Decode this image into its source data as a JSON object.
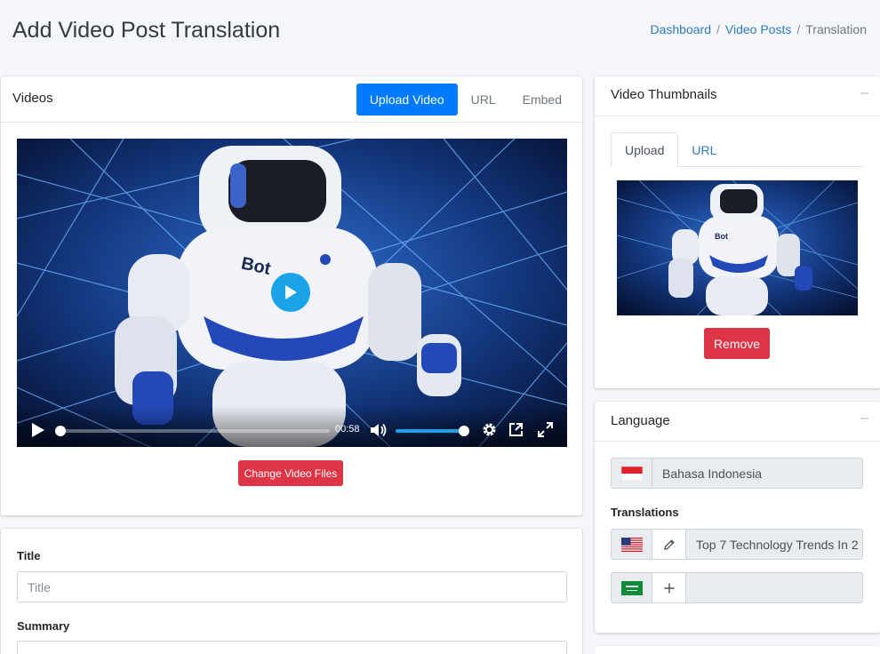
{
  "page": {
    "title": "Add Video Post Translation"
  },
  "breadcrumb": {
    "items": [
      "Dashboard",
      "Video Posts"
    ],
    "separator": "/",
    "active": "Translation"
  },
  "videos": {
    "title": "Videos",
    "tabs": [
      {
        "label": "Upload Video",
        "active": true
      },
      {
        "label": "URL",
        "active": false
      },
      {
        "label": "Embed",
        "active": false
      }
    ],
    "player": {
      "time": "00:58",
      "progress_fraction": 0.02,
      "volume_fraction": 1.0,
      "robot_text": "Bot"
    },
    "change_button": "Change Video Files"
  },
  "form": {
    "title_label": "Title",
    "title_placeholder": "Title",
    "summary_label": "Summary"
  },
  "thumbnails": {
    "title": "Video Thumbnails",
    "collapse_symbol": "–",
    "tabs": [
      {
        "label": "Upload",
        "active": true
      },
      {
        "label": "URL",
        "active": false
      }
    ],
    "remove_button": "Remove"
  },
  "language": {
    "title": "Language",
    "collapse_symbol": "–",
    "current": {
      "flag": "indonesia-flag-icon",
      "name": "Bahasa Indonesia"
    },
    "translations_label": "Translations",
    "translations": [
      {
        "flag": "us-flag-icon",
        "action_icon": "pencil-icon",
        "text": "Top 7 Technology Trends In 2"
      },
      {
        "flag": "saudi-flag-icon",
        "action_icon": "plus-icon",
        "text": ""
      }
    ]
  },
  "colors": {
    "primary": "#007bff",
    "danger": "#dc3545",
    "link": "#2f7bbd",
    "player_accent": "#1aa3e8"
  }
}
